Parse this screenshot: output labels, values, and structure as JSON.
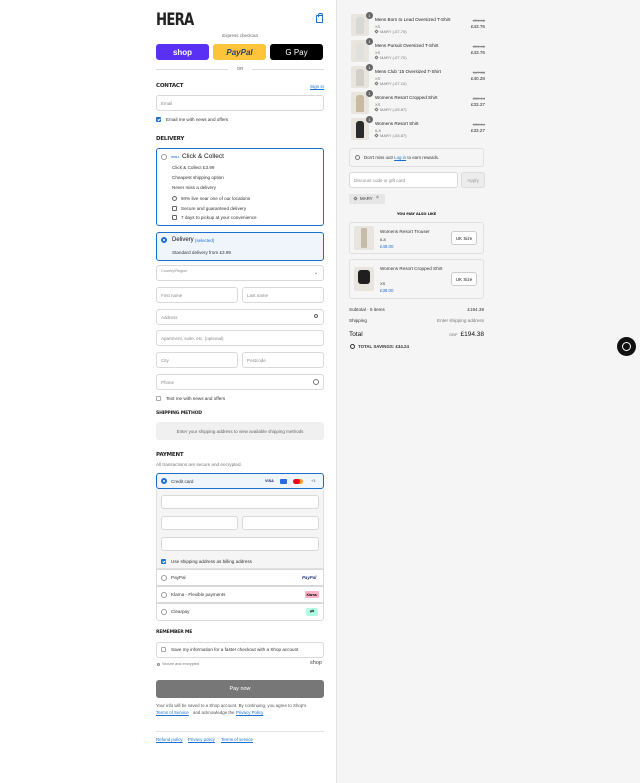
{
  "brand": {
    "logo": "HERA"
  },
  "express": {
    "title": "Express checkout",
    "shop": "shop",
    "paypal": "PayPal",
    "gpay": "G Pay",
    "or": "OR"
  },
  "contact": {
    "heading": "CONTACT",
    "sign_in": "Sign in",
    "email_placeholder": "Email",
    "news_label": "Email me with news and offers"
  },
  "delivery": {
    "heading": "DELIVERY",
    "cc_title": "Click & Collect",
    "cc_price": "Click & Collect £3.99",
    "cc_line1": "Cheapest shipping option",
    "cc_line2": "Never miss a delivery",
    "cc_feat1": "94% live near one of our locations",
    "cc_feat2": "Secure and guaranteed delivery",
    "cc_feat3": "7 days to pickup at your convenience",
    "del_title": "Delivery",
    "del_selected": "(selected)",
    "del_sub": "Standard delivery from £3.99",
    "country_label": "Country/Region",
    "first_name": "First name",
    "last_name": "Last name",
    "address": "Address",
    "apartment": "Apartment, suite, etc. (optional)",
    "city": "City",
    "postcode": "Postcode",
    "phone": "Phone",
    "text_me": "Text me with news and offers"
  },
  "shipping_method": {
    "heading": "SHIPPING METHOD",
    "note": "Enter your shipping address to view available shipping methods"
  },
  "payment": {
    "heading": "PAYMENT",
    "sub": "All transactions are secure and encrypted.",
    "credit_card": "Credit card",
    "visa": "VISA",
    "more": "+3",
    "billing": "Use shipping address as billing address",
    "paypal": "PayPal",
    "paypal_badge": "PayPal",
    "klarna": "Klarna - Flexible payments",
    "klarna_badge": "Klarna.",
    "clearpay": "Clearpay",
    "clearpay_badge": "⇄"
  },
  "remember": {
    "heading": "REMEMBER ME",
    "save_info": "Save my information for a faster checkout with a Shop account",
    "secure": "Secure and encrypted",
    "shop": "shop"
  },
  "pay_now": "Pay now",
  "legal": {
    "line1": "Your info will be saved to a Shop account. By continuing, you agree to Shop's",
    "terms": "Terms of Service",
    "and": "and acknowledge the",
    "privacy": "Privacy Policy"
  },
  "footer": {
    "refund": "Refund policy",
    "privacy": "Privacy policy",
    "terms": "Terms of service"
  },
  "cart": {
    "items": [
      {
        "qty": "1",
        "name": "Mens Born to Lead Oversized T-Shirt",
        "size": "XS",
        "discount": "MARY (-£7.70)",
        "old": "£51.46",
        "price": "£43.76",
        "color": "#d8d8d6"
      },
      {
        "qty": "1",
        "name": "Mens Pursuit Oversized T-Shirt",
        "size": "XS",
        "discount": "MARY (-£7.70)",
        "old": "£51.46",
        "price": "£43.76",
        "color": "#e0e0de"
      },
      {
        "qty": "1",
        "name": "Mens Club '15 Oversized T-Shirt",
        "size": "XS",
        "discount": "MARY (-£7.10)",
        "old": "£47.38",
        "price": "£40.28",
        "color": "#d2cfc8"
      },
      {
        "qty": "1",
        "name": "Womens Resort Cropped Shirt",
        "size": "XS",
        "discount": "MARY (-£5.87)",
        "old": "£39.14",
        "price": "£33.27",
        "color": "#c9b9a0"
      },
      {
        "qty": "1",
        "name": "Womens Resort Shirt",
        "size": "6-8",
        "discount": "MARY (-£5.87)",
        "old": "£39.14",
        "price": "£33.27",
        "color": "#2a2a2a"
      }
    ],
    "login_note_pre": "Don't miss out!",
    "login_link": "Log in",
    "login_note_post": "to earn rewards.",
    "discount_placeholder": "Discount code or gift card",
    "apply": "Apply",
    "code": "MARY",
    "you_may_like": "YOU MAY ALSO LIKE",
    "recos": [
      {
        "name": "Womens Resort Trouser",
        "size": "6-8",
        "price": "£49.00",
        "btn": "UK Size",
        "color": "#c8bca8"
      },
      {
        "name": "Womens Resort Cropped Shirt",
        "size": "XS",
        "price": "£38.00",
        "btn": "UK Size",
        "color": "#1f1f1f"
      }
    ],
    "subtotal_label": "Subtotal · 5 items",
    "subtotal": "£194.38",
    "shipping_label": "Shipping",
    "shipping_value": "Enter shipping address",
    "total_label": "Total",
    "currency": "GBP",
    "total": "£194.38",
    "savings": "TOTAL SAVINGS: £34.24"
  },
  "colors": {
    "accent": "#1b6fd1",
    "shop_purple": "#5a31f4",
    "paypal_yellow": "#ffc439"
  }
}
